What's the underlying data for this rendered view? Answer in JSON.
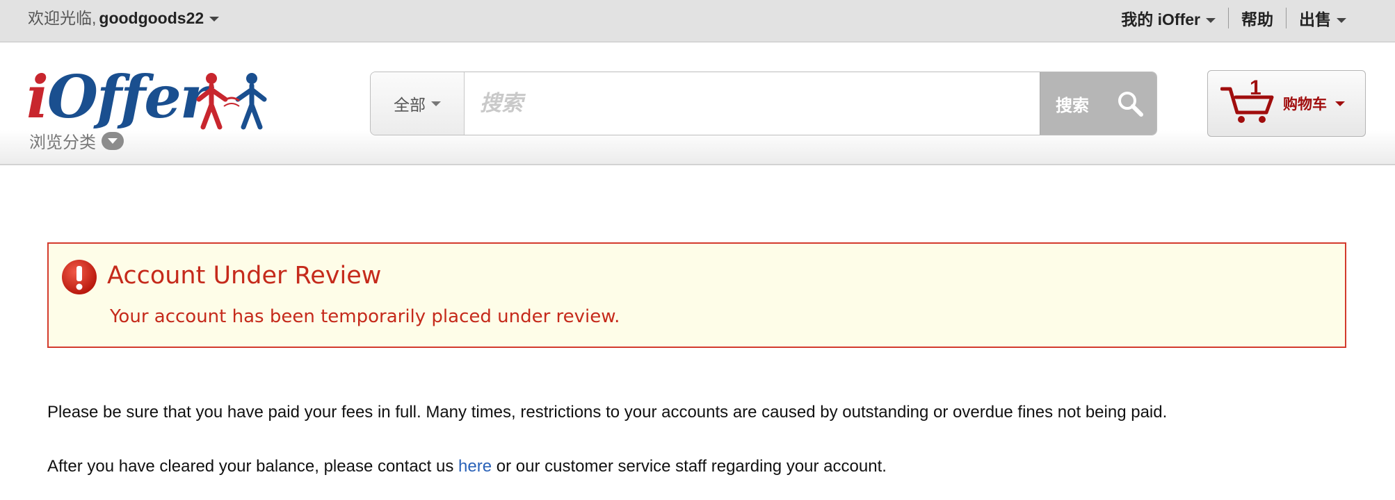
{
  "topbar": {
    "welcome_prefix": "欢迎光临,",
    "username": "goodgoods22",
    "nav": {
      "my_ioffer": "我的 iOffer",
      "help": "帮助",
      "sell": "出售"
    }
  },
  "header": {
    "logo_text_i": "i",
    "logo_text_rest": "Offer",
    "browse_label": "浏览分类",
    "search": {
      "category": "全部",
      "placeholder": "搜索",
      "button_label": "搜索"
    },
    "cart": {
      "count": "1",
      "label": "购物车"
    }
  },
  "alert": {
    "title": "Account Under Review",
    "message": "Your account has been temporarily placed under review."
  },
  "body": {
    "para1": "Please be sure that you have paid your fees in full. Many times, restrictions to your accounts are caused by outstanding or overdue fines not being paid.",
    "para2_before": "After you have cleared your balance, please contact us ",
    "para2_link": "here",
    "para2_after": " or our customer service staff regarding your account."
  },
  "colors": {
    "alert_red": "#c52a1b",
    "alert_bg": "#fefde8",
    "link_blue": "#2a62b8",
    "cart_red": "#a00d0d",
    "logo_blue": "#1a4f8f",
    "logo_red": "#c8262e"
  },
  "icons": {
    "alert": "exclamation-circle-icon",
    "search": "magnifier-icon",
    "cart": "shopping-cart-icon"
  }
}
